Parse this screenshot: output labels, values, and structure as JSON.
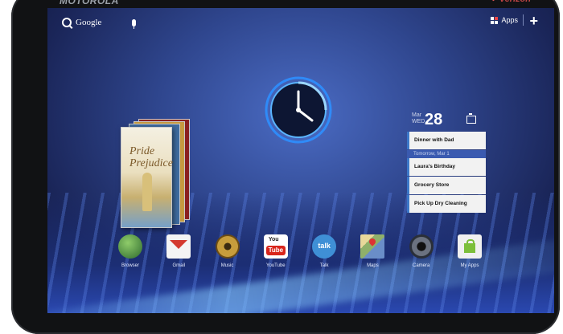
{
  "device": {
    "brand": "MOTOROLA",
    "carrier": "verizon"
  },
  "status_bar": {
    "search_label": "Google",
    "apps_label": "Apps"
  },
  "books_widget": {
    "cover_title": "Pride Prejudice"
  },
  "calendar_widget": {
    "month": "Mar",
    "weekday": "WED",
    "date": "28",
    "divider": "Tomorrow, Mar 1",
    "events": [
      "Dinner with Dad",
      "Laura's Birthday",
      "Grocery Store",
      "Pick Up Dry Cleaning"
    ]
  },
  "dock": {
    "apps": [
      {
        "label": "Browser",
        "icon": "browser-icon"
      },
      {
        "label": "Gmail",
        "icon": "gmail-icon"
      },
      {
        "label": "Music",
        "icon": "music-icon"
      },
      {
        "label": "YouTube",
        "icon": "youtube-icon"
      },
      {
        "label": "Talk",
        "icon": "talk-icon"
      },
      {
        "label": "Maps",
        "icon": "maps-icon"
      },
      {
        "label": "Camera",
        "icon": "camera-icon"
      },
      {
        "label": "My Apps",
        "icon": "my-apps-icon"
      }
    ]
  },
  "icon_text": {
    "youtube_top": "You",
    "youtube_bottom": "Tube",
    "talk": "talk"
  },
  "colors": {
    "wallpaper": "#2f468e",
    "accent": "#3c78c8"
  }
}
